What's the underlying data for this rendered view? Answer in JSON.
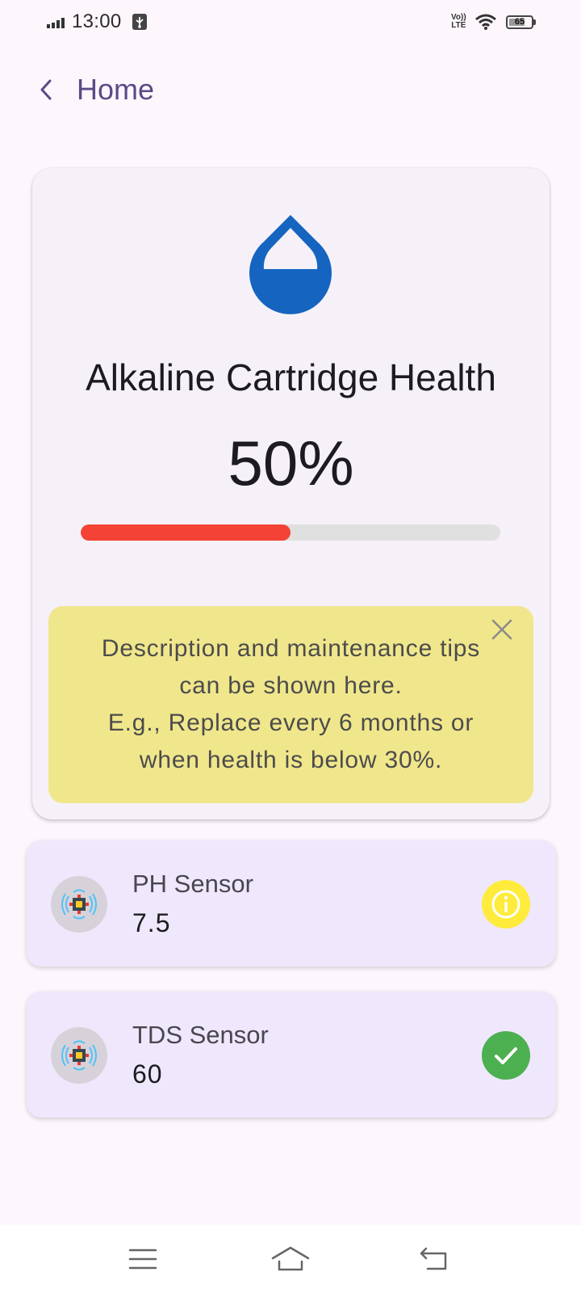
{
  "status_bar": {
    "time": "13:00",
    "battery_level": "65",
    "volte_line1": "Vo))",
    "volte_line2": "LTE",
    "icons": [
      "signal-icon",
      "usb-debug-icon",
      "volte-icon",
      "wifi-icon",
      "battery-icon"
    ]
  },
  "header": {
    "back_icon": "chevron-left-icon",
    "title": "Home"
  },
  "cartridge": {
    "icon": "water-drop-icon",
    "title": "Alkaline Cartridge Health",
    "health_text": "50%",
    "health_fraction": 0.5,
    "progress_color": "#f44336",
    "tips_lines": [
      "Description and maintenance tips",
      "can be shown here.",
      "E.g., Replace every 6 months or",
      "when health is below 30%."
    ],
    "tips_background": "#f0e68c",
    "close_icon": "close-icon"
  },
  "sensors": [
    {
      "name": "PH Sensor",
      "value": "7.5",
      "icon": "sensor-chip-icon",
      "status_icon": "info-icon",
      "status_color": "#ffeb3b"
    },
    {
      "name": "TDS Sensor",
      "value": "60",
      "icon": "sensor-chip-icon",
      "status_icon": "check-icon",
      "status_color": "#4caf50"
    }
  ],
  "nav_bar": {
    "items": [
      "menu-icon",
      "home-icon",
      "back-icon"
    ]
  },
  "colors": {
    "accent": "#5a4a86",
    "drop_blue": "#1565c0",
    "background": "#fdf7fd"
  }
}
